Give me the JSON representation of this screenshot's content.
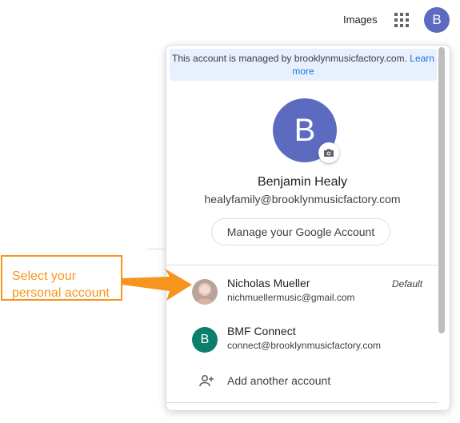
{
  "topbar": {
    "images_label": "Images",
    "avatar_letter": "B"
  },
  "panel": {
    "managed_text": "This account is managed by brooklynmusicfactory.com.",
    "managed_link": "Learn more",
    "avatar_letter": "B",
    "name": "Benjamin Healy",
    "email": "healyfamily@brooklynmusicfactory.com",
    "manage_button": "Manage your Google Account",
    "accounts": [
      {
        "name": "Nicholas Mueller",
        "email": "nichmuellermusic@gmail.com",
        "badge": "Default"
      },
      {
        "name": "BMF Connect",
        "email": "connect@brooklynmusicfactory.com",
        "avatar_letter": "B"
      }
    ],
    "add_account": "Add another account"
  },
  "callout": {
    "line1": "Select your",
    "line2": "personal account"
  },
  "colors": {
    "accent": "#1a73e8",
    "avatar": "#5c6bc0",
    "bmf_avatar": "#0b7f6c",
    "callout": "#f7941d"
  }
}
